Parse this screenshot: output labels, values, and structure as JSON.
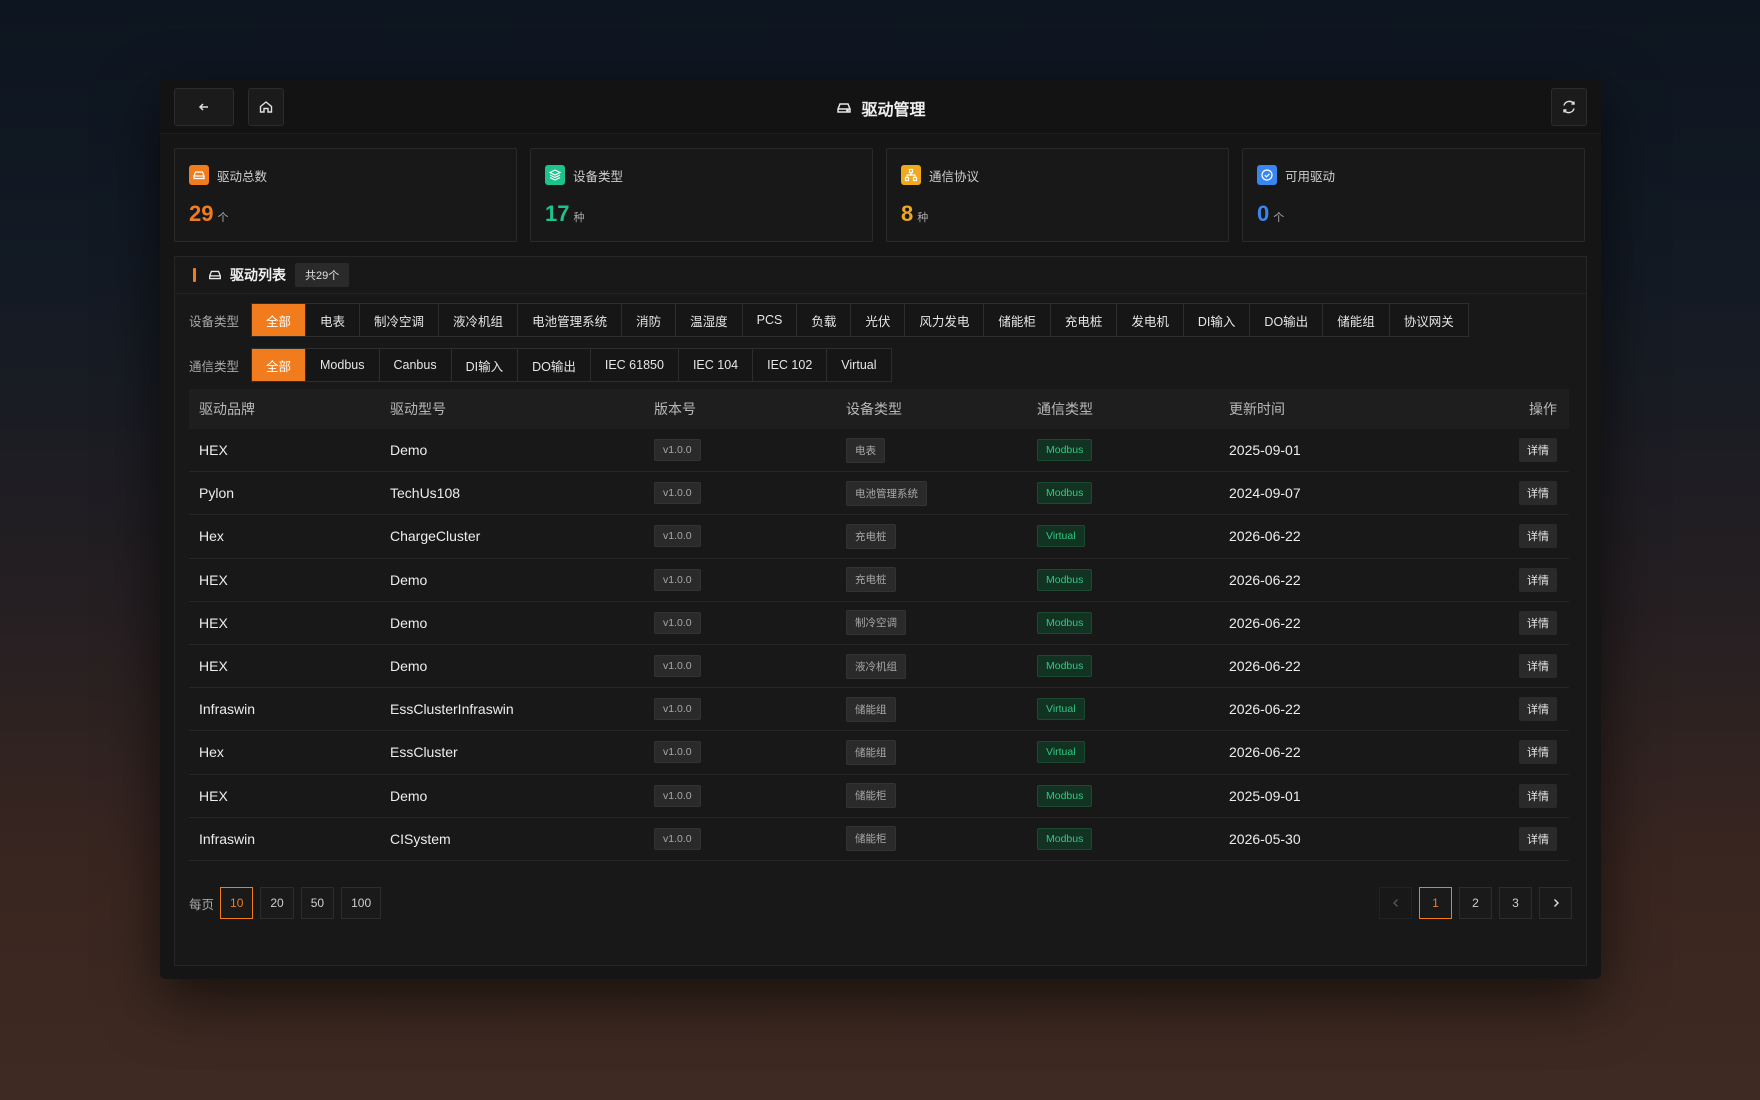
{
  "header": {
    "title": "驱动管理"
  },
  "stats": [
    {
      "label": "驱动总数",
      "value": "29",
      "unit": "个",
      "color": "#f07c1e"
    },
    {
      "label": "设备类型",
      "value": "17",
      "unit": "种",
      "color": "#1ec38b"
    },
    {
      "label": "通信协议",
      "value": "8",
      "unit": "种",
      "color": "#f0a81e"
    },
    {
      "label": "可用驱动",
      "value": "0",
      "unit": "个",
      "color": "#3a86f0"
    }
  ],
  "panel": {
    "title": "驱动列表",
    "count": "共29个"
  },
  "filters": {
    "device_label": "设备类型",
    "device_types": [
      "全部",
      "电表",
      "制冷空调",
      "液冷机组",
      "电池管理系统",
      "消防",
      "温湿度",
      "PCS",
      "负载",
      "光伏",
      "风力发电",
      "储能柜",
      "充电桩",
      "发电机",
      "DI输入",
      "DO输出",
      "储能组",
      "协议网关"
    ],
    "comm_label": "通信类型",
    "comm_types": [
      "全部",
      "Modbus",
      "Canbus",
      "DI输入",
      "DO输出",
      "IEC 61850",
      "IEC 104",
      "IEC 102",
      "Virtual"
    ]
  },
  "table": {
    "columns": [
      "驱动品牌",
      "驱动型号",
      "版本号",
      "设备类型",
      "通信类型",
      "更新时间",
      "操作"
    ],
    "detail_label": "详情",
    "rows": [
      {
        "brand": "HEX",
        "model": "Demo",
        "version": "v1.0.0",
        "device": "电表",
        "comm": "Modbus",
        "time": "2025-09-01"
      },
      {
        "brand": "Pylon",
        "model": "TechUs108",
        "version": "v1.0.0",
        "device": "电池管理系统",
        "comm": "Modbus",
        "time": "2024-09-07"
      },
      {
        "brand": "Hex",
        "model": "ChargeCluster",
        "version": "v1.0.0",
        "device": "充电桩",
        "comm": "Virtual",
        "time": "2026-06-22"
      },
      {
        "brand": "HEX",
        "model": "Demo",
        "version": "v1.0.0",
        "device": "充电桩",
        "comm": "Modbus",
        "time": "2026-06-22"
      },
      {
        "brand": "HEX",
        "model": "Demo",
        "version": "v1.0.0",
        "device": "制冷空调",
        "comm": "Modbus",
        "time": "2026-06-22"
      },
      {
        "brand": "HEX",
        "model": "Demo",
        "version": "v1.0.0",
        "device": "液冷机组",
        "comm": "Modbus",
        "time": "2026-06-22"
      },
      {
        "brand": "Infraswin",
        "model": "EssClusterInfraswin",
        "version": "v1.0.0",
        "device": "储能组",
        "comm": "Virtual",
        "time": "2026-06-22"
      },
      {
        "brand": "Hex",
        "model": "EssCluster",
        "version": "v1.0.0",
        "device": "储能组",
        "comm": "Virtual",
        "time": "2026-06-22"
      },
      {
        "brand": "HEX",
        "model": "Demo",
        "version": "v1.0.0",
        "device": "储能柜",
        "comm": "Modbus",
        "time": "2025-09-01"
      },
      {
        "brand": "Infraswin",
        "model": "CISystem",
        "version": "v1.0.0",
        "device": "储能柜",
        "comm": "Modbus",
        "time": "2026-05-30"
      }
    ]
  },
  "pagination": {
    "per_page_label": "每页",
    "sizes": [
      "10",
      "20",
      "50",
      "100"
    ],
    "pages": [
      "1",
      "2",
      "3"
    ]
  },
  "colors": {
    "accent": "#f07c1e",
    "success": "#2fc883"
  }
}
